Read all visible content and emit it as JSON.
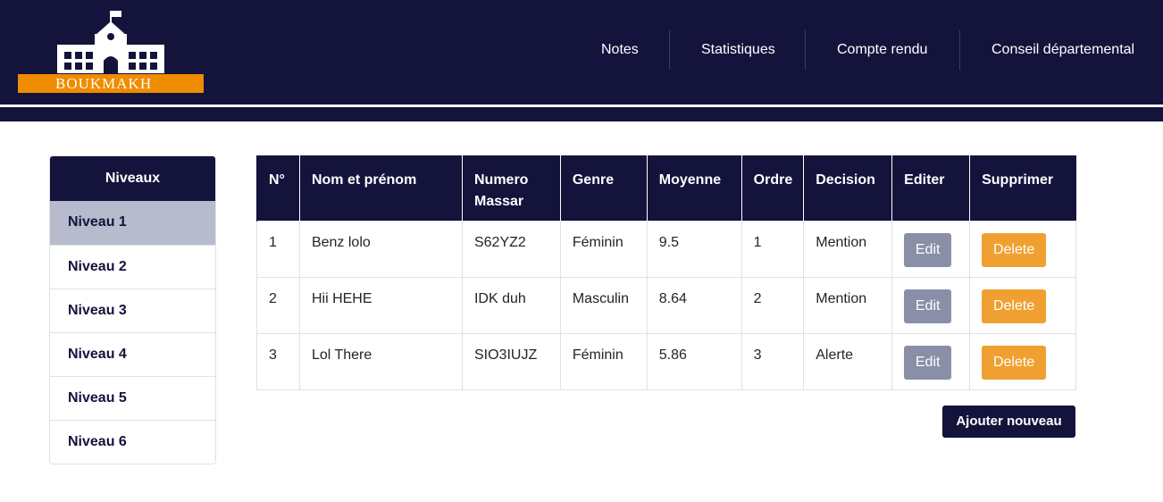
{
  "brand": {
    "name": "BOUKMAKH"
  },
  "nav": {
    "items": [
      {
        "label": "Notes"
      },
      {
        "label": "Statistiques"
      },
      {
        "label": "Compte rendu"
      },
      {
        "label": "Conseil départemental"
      }
    ]
  },
  "sidebar": {
    "title": "Niveaux",
    "items": [
      {
        "label": "Niveau 1",
        "active": true
      },
      {
        "label": "Niveau 2"
      },
      {
        "label": "Niveau 3"
      },
      {
        "label": "Niveau 4"
      },
      {
        "label": "Niveau 5"
      },
      {
        "label": "Niveau 6"
      }
    ]
  },
  "table": {
    "headers": [
      "N°",
      "Nom et prénom",
      "Numero Massar",
      "Genre",
      "Moyenne",
      "Ordre",
      "Decision",
      "Editer",
      "Supprimer"
    ],
    "rows": [
      {
        "num": "1",
        "name": "Benz lolo",
        "massar": "S62YZ2",
        "genre": "Féminin",
        "moyenne": "9.5",
        "ordre": "1",
        "decision": "Mention"
      },
      {
        "num": "2",
        "name": "Hii HEHE",
        "massar": "IDK duh",
        "genre": "Masculin",
        "moyenne": "8.64",
        "ordre": "2",
        "decision": "Mention"
      },
      {
        "num": "3",
        "name": "Lol There",
        "massar": "SIO3IUJZ",
        "genre": "Féminin",
        "moyenne": "5.86",
        "ordre": "3",
        "decision": "Alerte"
      }
    ],
    "edit_label": "Edit",
    "delete_label": "Delete"
  },
  "actions": {
    "add_label": "Ajouter nouveau"
  },
  "colors": {
    "primary": "#13133c",
    "accent": "#f08c00",
    "edit": "#8a8fa8",
    "delete": "#f0a030",
    "active_item": "#b8bbcb"
  }
}
